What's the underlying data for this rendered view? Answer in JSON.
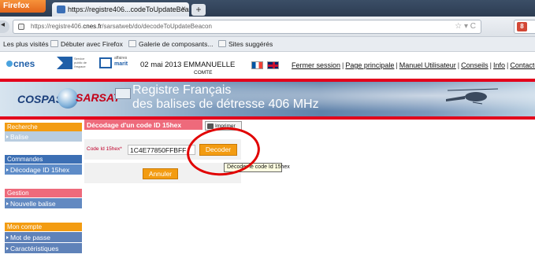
{
  "browser": {
    "app_button": "Firefox",
    "tab_title": "https://registre406...codeToUpdateBeacon",
    "tab_close": "×",
    "new_tab": "+",
    "url_prefix": "https://registre406.",
    "url_host": "cnes.fr",
    "url_path": "/sarsatweb/do/decodeToUpdateBeacon",
    "url_icons": "☆ ▾ C",
    "search_engine": "8",
    "bookmarks": [
      "Les plus visités",
      "Débuter avec Firefox",
      "Galerie de composants...",
      "Sites suggérés"
    ]
  },
  "header": {
    "cnes_logo": "cnes",
    "logo2_text": "Service public de l'espace",
    "logo3_small": "affaires",
    "logo3_text": "marit",
    "date_user": "02 mai 2013 EMMANUELLE",
    "comte": "COMTE",
    "links": [
      "Fermer session",
      "Page principale",
      "Manuel Utilisateur",
      "Conseils",
      "Info",
      "Contactez nous"
    ]
  },
  "banner": {
    "cospas": "COSPAS",
    "sarsat": "SARSAT",
    "title_line1": "Registre Français",
    "title_line2": "des balises de détresse 406 MHz"
  },
  "sidebar": {
    "recherche": {
      "title": "Recherche",
      "items": [
        "Balise"
      ]
    },
    "commandes": {
      "title": "Commandes",
      "items": [
        "Décodage ID 15hex"
      ]
    },
    "gestion": {
      "title": "Gestion",
      "items": [
        "Nouvelle balise"
      ]
    },
    "mon_compte": {
      "title": "Mon compte",
      "items": [
        "Mot de passe",
        "Caractéristiques"
      ]
    }
  },
  "form": {
    "title": "Décodage d'un code ID 15hex",
    "print_label": "Imprimer",
    "code_label": "Code Id 15hex*",
    "code_value": "1C4E77850FFBFF",
    "decoder_label": "Decoder",
    "tooltip": "Décoder le code Id 15hex",
    "annuler_label": "Annuler"
  },
  "colors": {
    "accent_orange": "#f39c12",
    "accent_red": "#e3001b",
    "accent_blue": "#3c6fb4",
    "accent_pink": "#ee6a7b"
  }
}
